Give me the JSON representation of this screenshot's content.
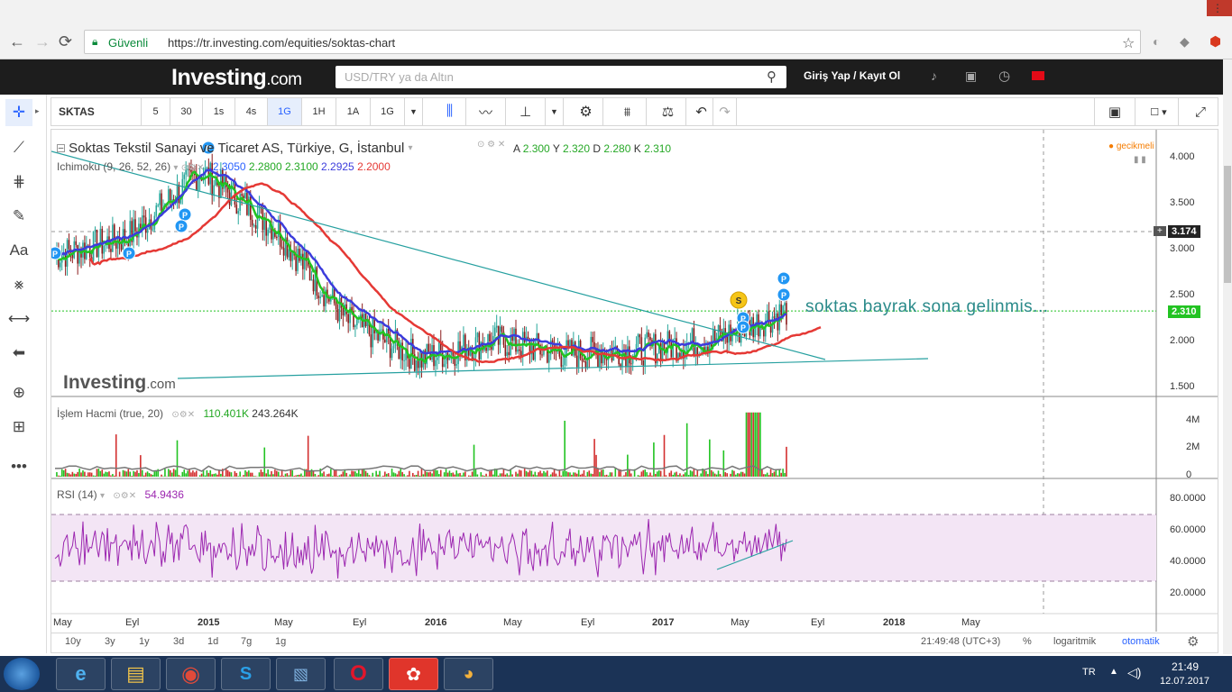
{
  "browser": {
    "secure_label": "Güvenli",
    "url": "https://tr.investing.com/equities/soktas-chart"
  },
  "site": {
    "logo_main": "Investing",
    "logo_suffix": ".com",
    "search_placeholder": "USD/TRY ya da Altın",
    "login_label": "Giriş Yap / Kayıt Ol"
  },
  "toolbar": {
    "symbol": "SKTAS",
    "intervals": [
      "5",
      "30",
      "1s",
      "4s",
      "1G",
      "1H",
      "1A",
      "1G"
    ],
    "active_interval": "1G"
  },
  "legend": {
    "title": "Soktas Tekstil Sanayi ve Ticaret AS, Türkiye, G, İstanbul",
    "ohlc": {
      "A": "2.300",
      "Y": "2.320",
      "D": "2.280",
      "K": "2.310"
    },
    "delayed": "gecikmeli",
    "ichimoku_label": "Ichimoku (9, 26, 52, 26)",
    "ichimoku_values": [
      "2.3050",
      "2.2800",
      "2.3100",
      "2.2925",
      "2.2000"
    ],
    "volume_label": "İşlem Hacmi (true, 20)",
    "volume_values": [
      "110.401K",
      "243.264K"
    ],
    "rsi_label": "RSI (14)",
    "rsi_value": "54.9436"
  },
  "annotation": "soktas bayrak sona gelinmis...",
  "watermark": {
    "main": "Investing",
    "suffix": ".com"
  },
  "price_axis": [
    "4.000",
    "3.500",
    "3.000",
    "2.500",
    "2.000",
    "1.500"
  ],
  "price_badges": {
    "crosshair": "3.174",
    "last": "2.310"
  },
  "volume_axis": [
    "4M",
    "2M",
    "0"
  ],
  "rsi_axis": [
    "80.0000",
    "60.0000",
    "40.0000",
    "20.0000"
  ],
  "time_axis": [
    "May",
    "Eyl",
    "2015",
    "May",
    "Eyl",
    "2016",
    "May",
    "Eyl",
    "2017",
    "May",
    "Eyl",
    "2018",
    "May"
  ],
  "ranges": [
    "10y",
    "3y",
    "1y",
    "3d",
    "1d",
    "7g",
    "1g"
  ],
  "bottom_status": {
    "clock": "21:49:48 (UTC+3)",
    "percent": "%",
    "log": "logaritmik",
    "auto": "otomatik"
  },
  "taskbar": {
    "lang": "TR",
    "time": "21:49",
    "date": "12.07.2017"
  },
  "chart_data": {
    "type": "line",
    "title": "Soktas Tekstil Sanayi ve Ticaret AS, Türkiye, G, İstanbul",
    "x": [
      "2014-05",
      "2014-09",
      "2015-01",
      "2015-05",
      "2015-09",
      "2016-01",
      "2016-05",
      "2016-09",
      "2017-01",
      "2017-05",
      "2017-07"
    ],
    "series": [
      {
        "name": "price",
        "values": [
          2.9,
          3.1,
          3.8,
          3.2,
          2.2,
          1.8,
          2.0,
          1.85,
          1.9,
          2.0,
          2.31
        ]
      }
    ],
    "ylim": [
      1.4,
      4.2
    ],
    "rsi_last": 54.9436,
    "last_price": 2.31
  },
  "colors": {
    "accent": "#2962ff",
    "ichimoku_green": "#22c322",
    "ichimoku_red": "#e53935",
    "ichimoku_blue": "#3c3cdc",
    "rsi": "#9c27b0"
  }
}
